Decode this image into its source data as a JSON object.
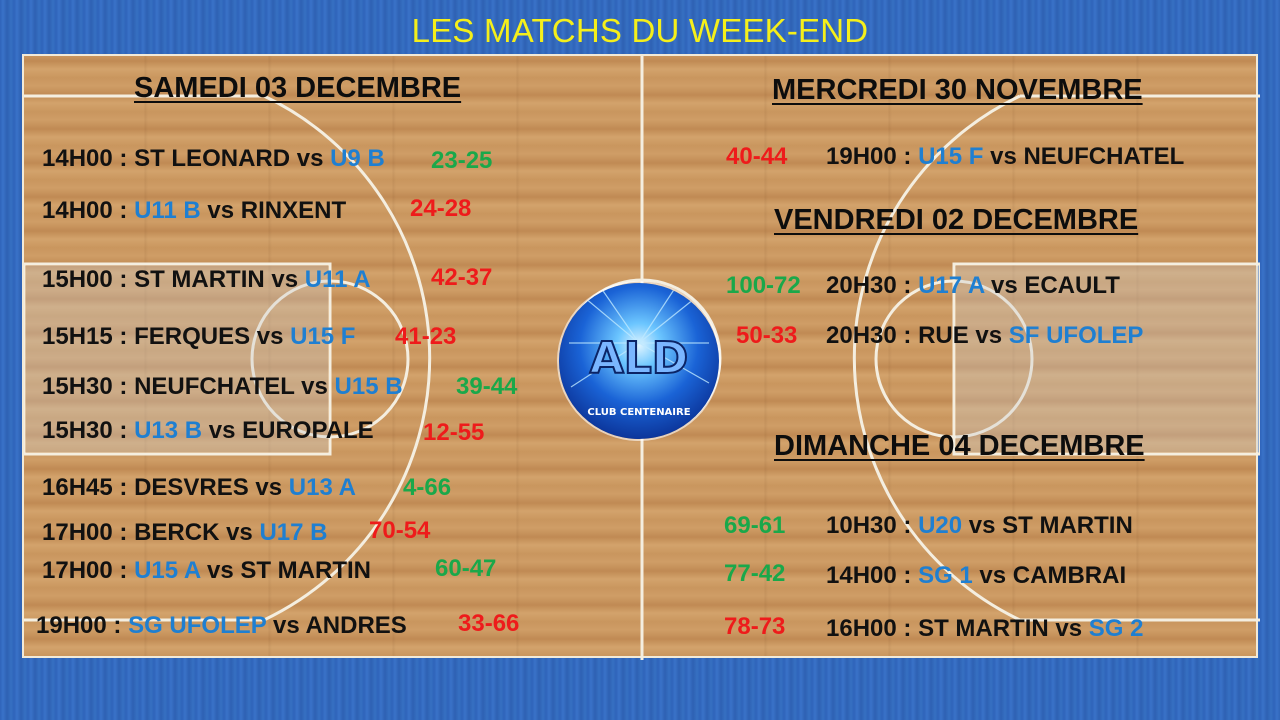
{
  "title": "LES MATCHS DU WEEK-END",
  "colors": {
    "team": "#1f7fd1",
    "win": "#1aa84a",
    "loss": "#ee1b1b",
    "title": "#f5ef1a"
  },
  "logo": {
    "letters": "ALD",
    "subtitle": "CLUB CENTENAIRE"
  },
  "saturday": {
    "heading": "SAMEDI 03 DECEMBRE",
    "matches": [
      {
        "time": "14H00 : ",
        "home": "ST LEONARD",
        "vs": " vs ",
        "away": "U9 B",
        "score": "23-25",
        "result": "win",
        "home_club": false,
        "away_club": true
      },
      {
        "time": "14H00 : ",
        "home": "U11 B",
        "vs": " vs ",
        "away": "RINXENT",
        "score": "24-28",
        "result": "loss",
        "home_club": true,
        "away_club": false
      },
      {
        "time": "15H00 : ",
        "home": "ST MARTIN",
        "vs": " vs ",
        "away": "U11 A",
        "score": "42-37",
        "result": "loss",
        "home_club": false,
        "away_club": true
      },
      {
        "time": "15H15 : ",
        "home": "FERQUES",
        "vs": " vs ",
        "away": "U15 F",
        "score": "41-23",
        "result": "loss",
        "home_club": false,
        "away_club": true
      },
      {
        "time": "15H30 : ",
        "home": "NEUFCHATEL",
        "vs": " vs ",
        "away": "U15 B",
        "score": "39-44",
        "result": "win",
        "home_club": false,
        "away_club": true
      },
      {
        "time": "15H30 : ",
        "home": "U13 B",
        "vs": " vs ",
        "away": "EUROPALE",
        "score": "12-55",
        "result": "loss",
        "home_club": true,
        "away_club": false
      },
      {
        "time": "16H45 : ",
        "home": "DESVRES",
        "vs": " vs ",
        "away": "U13 A",
        "score": "4-66",
        "result": "win",
        "home_club": false,
        "away_club": true
      },
      {
        "time": "17H00 : ",
        "home": "BERCK",
        "vs": " vs ",
        "away": "U17 B",
        "score": "70-54",
        "result": "loss",
        "home_club": false,
        "away_club": true
      },
      {
        "time": "17H00 : ",
        "home": "U15 A",
        "vs": " vs ",
        "away": "ST MARTIN",
        "score": "60-47",
        "result": "win",
        "home_club": true,
        "away_club": false
      },
      {
        "time": "19H00 : ",
        "home": "SG UFOLEP",
        "vs": " vs ",
        "away": "ANDRES",
        "score": "33-66",
        "result": "loss",
        "home_club": true,
        "away_club": false
      }
    ]
  },
  "wednesday": {
    "heading": "MERCREDI 30 NOVEMBRE",
    "matches": [
      {
        "time": "19H00 : ",
        "home": "U15 F",
        "vs": " vs ",
        "away": "NEUFCHATEL",
        "score": "40-44",
        "result": "loss",
        "home_club": true,
        "away_club": false
      }
    ]
  },
  "friday": {
    "heading": "VENDREDI 02 DECEMBRE",
    "matches": [
      {
        "time": "20H30 : ",
        "home": "U17 A",
        "vs": " vs ",
        "away": "ECAULT",
        "score": "100-72",
        "result": "win",
        "home_club": true,
        "away_club": false
      },
      {
        "time": "20H30 : ",
        "home": "RUE",
        "vs": " vs ",
        "away": "SF UFOLEP",
        "score": "50-33",
        "result": "loss",
        "home_club": false,
        "away_club": true
      }
    ]
  },
  "sunday": {
    "heading": "DIMANCHE 04 DECEMBRE",
    "matches": [
      {
        "time": "10H30 : ",
        "home": "U20",
        "vs": " vs ",
        "away": "ST MARTIN",
        "score": "69-61",
        "result": "win",
        "home_club": true,
        "away_club": false
      },
      {
        "time": "14H00 : ",
        "home": "SG 1",
        "vs": " vs ",
        "away": "CAMBRAI",
        "score": "77-42",
        "result": "win",
        "home_club": true,
        "away_club": false
      },
      {
        "time": "16H00 : ",
        "home": "ST MARTIN",
        "vs": " vs ",
        "away": "SG 2",
        "score": "78-73",
        "result": "loss",
        "home_club": false,
        "away_club": true
      }
    ]
  }
}
